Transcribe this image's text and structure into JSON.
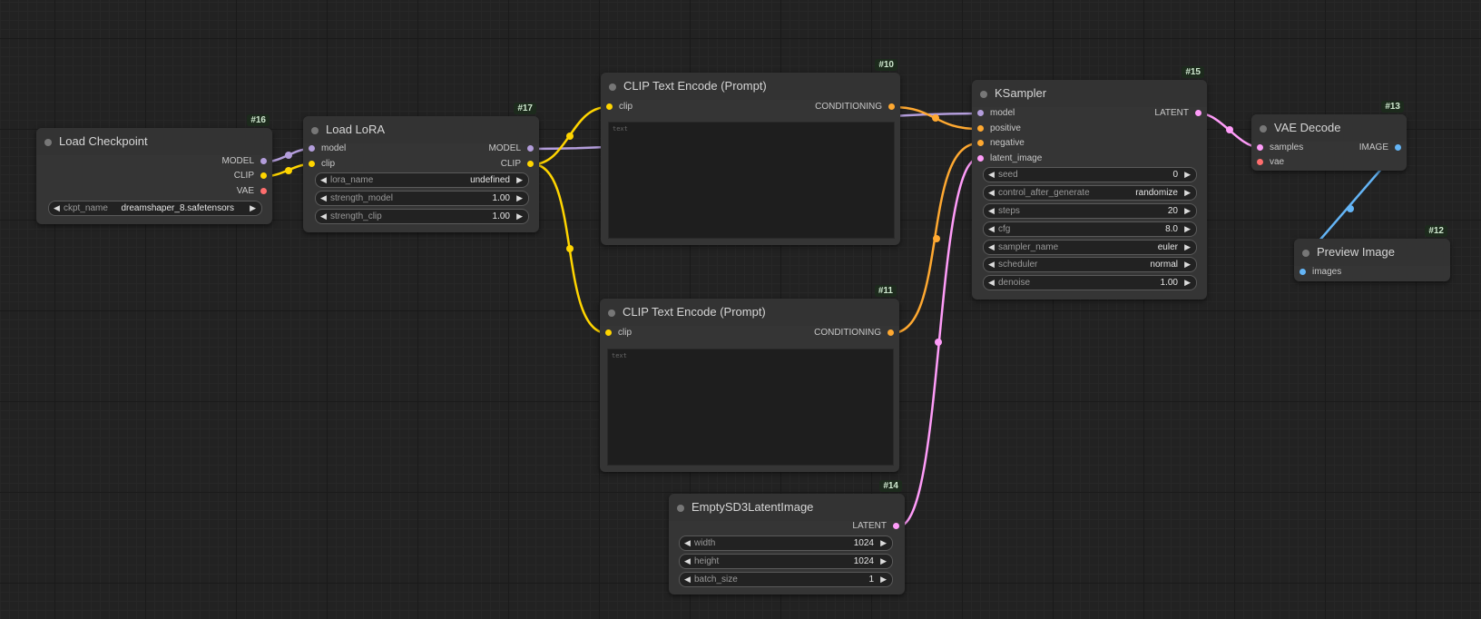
{
  "colors": {
    "model": "#b39ddb",
    "clip": "#ffd500",
    "vae": "#ff6e6e",
    "conditioning": "#ffa931",
    "latent": "#ff9cf9",
    "image": "#64b5f6"
  },
  "nodes": {
    "load_checkpoint": {
      "id": "#16",
      "title": "Load Checkpoint",
      "outputs": [
        "MODEL",
        "CLIP",
        "VAE"
      ],
      "widgets": [
        {
          "name": "ckpt_name",
          "value": "dreamshaper_8.safetensors"
        }
      ]
    },
    "load_lora": {
      "id": "#17",
      "title": "Load LoRA",
      "inputs": [
        "model",
        "clip"
      ],
      "outputs": [
        "MODEL",
        "CLIP"
      ],
      "widgets": [
        {
          "name": "lora_name",
          "value": "undefined"
        },
        {
          "name": "strength_model",
          "value": "1.00"
        },
        {
          "name": "strength_clip",
          "value": "1.00"
        }
      ]
    },
    "clip_text_encode_pos": {
      "id": "#10",
      "title": "CLIP Text Encode (Prompt)",
      "inputs": [
        "clip"
      ],
      "outputs": [
        "CONDITIONING"
      ],
      "text_placeholder": "text"
    },
    "clip_text_encode_neg": {
      "id": "#11",
      "title": "CLIP Text Encode (Prompt)",
      "inputs": [
        "clip"
      ],
      "outputs": [
        "CONDITIONING"
      ],
      "text_placeholder": "text"
    },
    "empty_latent": {
      "id": "#14",
      "title": "EmptySD3LatentImage",
      "outputs": [
        "LATENT"
      ],
      "widgets": [
        {
          "name": "width",
          "value": "1024"
        },
        {
          "name": "height",
          "value": "1024"
        },
        {
          "name": "batch_size",
          "value": "1"
        }
      ]
    },
    "ksampler": {
      "id": "#15",
      "title": "KSampler",
      "inputs": [
        "model",
        "positive",
        "negative",
        "latent_image"
      ],
      "outputs": [
        "LATENT"
      ],
      "widgets": [
        {
          "name": "seed",
          "value": "0"
        },
        {
          "name": "control_after_generate",
          "value": "randomize"
        },
        {
          "name": "steps",
          "value": "20"
        },
        {
          "name": "cfg",
          "value": "8.0"
        },
        {
          "name": "sampler_name",
          "value": "euler"
        },
        {
          "name": "scheduler",
          "value": "normal"
        },
        {
          "name": "denoise",
          "value": "1.00"
        }
      ]
    },
    "vae_decode": {
      "id": "#13",
      "title": "VAE Decode",
      "inputs": [
        "samples",
        "vae"
      ],
      "outputs": [
        "IMAGE"
      ]
    },
    "preview_image": {
      "id": "#12",
      "title": "Preview Image",
      "inputs": [
        "images"
      ]
    }
  }
}
